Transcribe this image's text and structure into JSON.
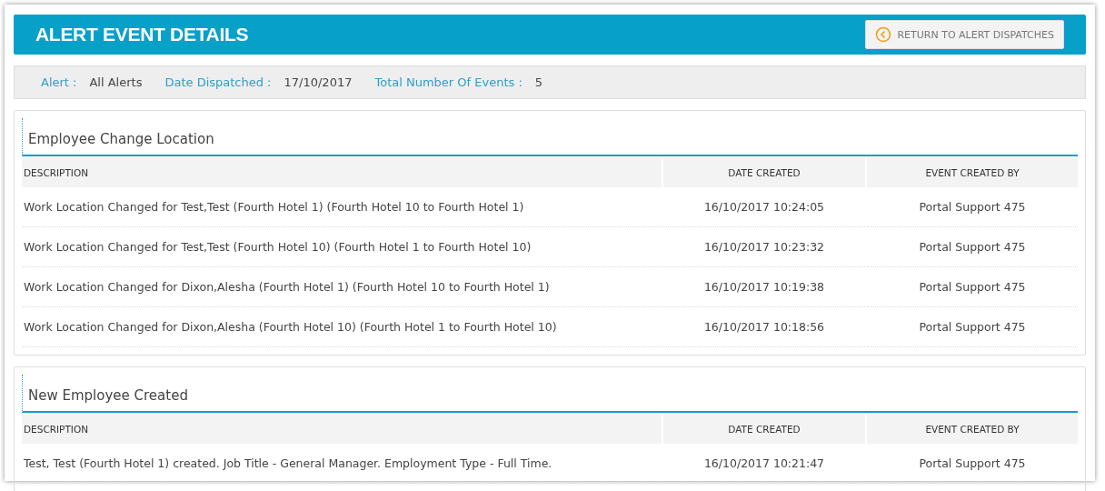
{
  "header": {
    "title": "ALERT EVENT DETAILS",
    "return_button": "RETURN TO ALERT DISPATCHES"
  },
  "summary": [
    {
      "label": "Alert :",
      "value": "All Alerts"
    },
    {
      "label": "Date Dispatched :",
      "value": "17/10/2017"
    },
    {
      "label": "Total Number Of Events :",
      "value": "5"
    }
  ],
  "sections": [
    {
      "title": "Employee Change Location",
      "columns": [
        "DESCRIPTION",
        "DATE CREATED",
        "EVENT CREATED BY"
      ],
      "rows": [
        [
          "Work Location Changed for Test,Test (Fourth Hotel 1) (Fourth Hotel 10 to Fourth Hotel 1)",
          "16/10/2017 10:24:05",
          "Portal Support 475"
        ],
        [
          "Work Location Changed for Test,Test (Fourth Hotel 10) (Fourth Hotel 1 to Fourth Hotel 10)",
          "16/10/2017 10:23:32",
          "Portal Support 475"
        ],
        [
          "Work Location Changed for Dixon,Alesha (Fourth Hotel 1) (Fourth Hotel 10 to Fourth Hotel 1)",
          "16/10/2017 10:19:38",
          "Portal Support 475"
        ],
        [
          "Work Location Changed for Dixon,Alesha (Fourth Hotel 10) (Fourth Hotel 1 to Fourth Hotel 10)",
          "16/10/2017 10:18:56",
          "Portal Support 475"
        ]
      ]
    },
    {
      "title": "New Employee Created",
      "columns": [
        "DESCRIPTION",
        "DATE CREATED",
        "EVENT CREATED BY"
      ],
      "rows": [
        [
          "Test, Test (Fourth Hotel 1) created. Job Title - General Manager. Employment Type - Full Time.",
          "16/10/2017 10:21:47",
          "Portal Support 475"
        ]
      ]
    }
  ]
}
